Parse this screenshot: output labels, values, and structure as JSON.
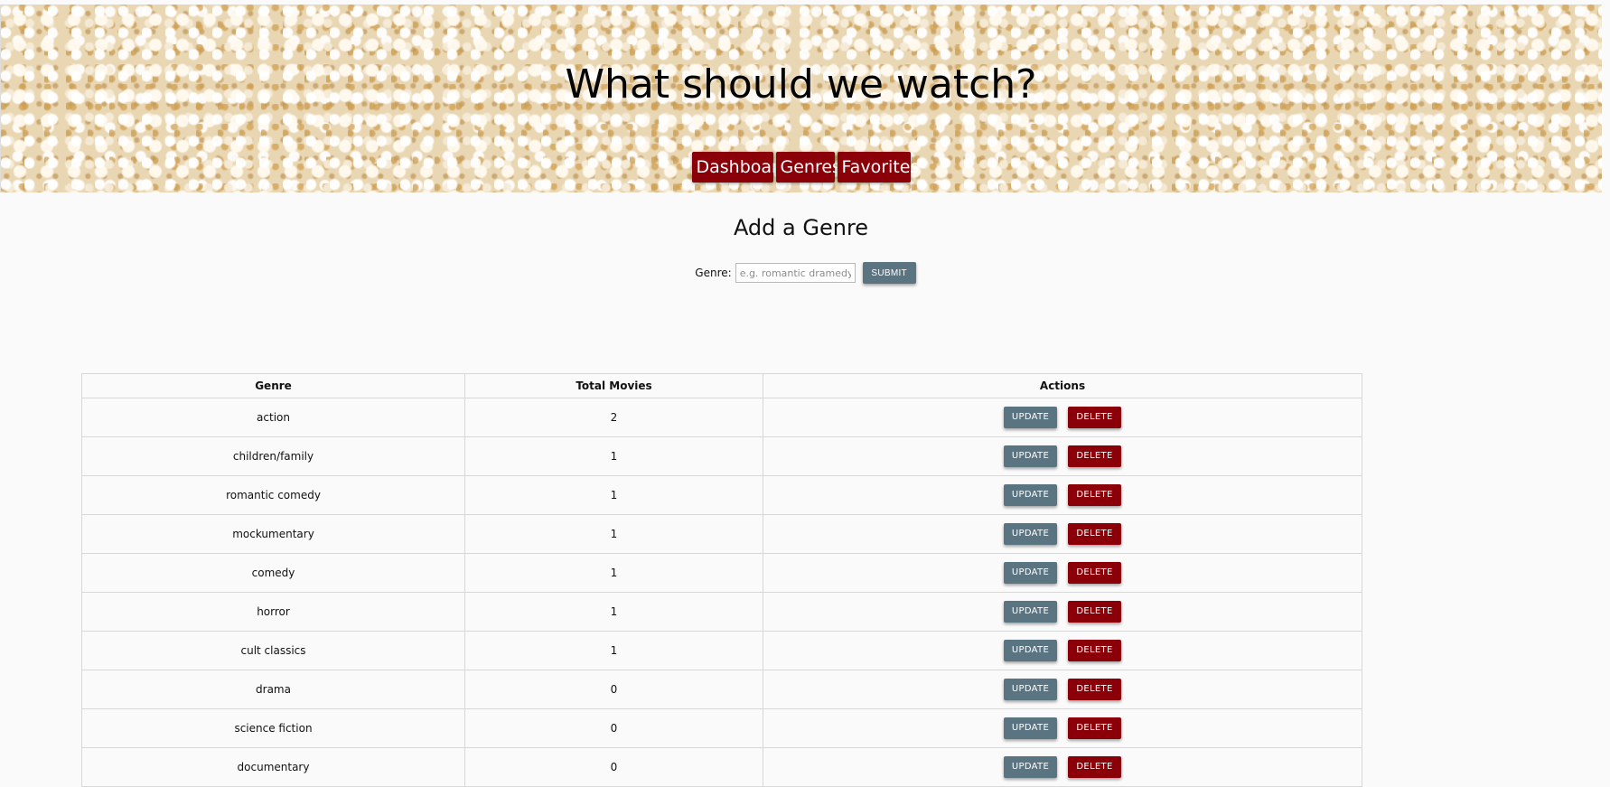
{
  "header": {
    "title": "What should we watch?",
    "nav": [
      "Dashboard",
      "Genres",
      "Favorites"
    ]
  },
  "form": {
    "heading": "Add a Genre",
    "label": "Genre:",
    "placeholder": "e.g. romantic dramedy",
    "submit": "SUBMIT"
  },
  "table": {
    "headers": [
      "Genre",
      "Total Movies",
      "Actions"
    ],
    "update_label": "UPDATE",
    "delete_label": "DELETE",
    "rows": [
      {
        "genre": "action",
        "total": "2"
      },
      {
        "genre": "children/family",
        "total": "1"
      },
      {
        "genre": "romantic comedy",
        "total": "1"
      },
      {
        "genre": "mockumentary",
        "total": "1"
      },
      {
        "genre": "comedy",
        "total": "1"
      },
      {
        "genre": "horror",
        "total": "1"
      },
      {
        "genre": "cult classics",
        "total": "1"
      },
      {
        "genre": "drama",
        "total": "0"
      },
      {
        "genre": "science fiction",
        "total": "0"
      },
      {
        "genre": "documentary",
        "total": "0"
      }
    ]
  },
  "colors": {
    "accent_red": "#8b0008",
    "update_blue": "#5b7482"
  }
}
